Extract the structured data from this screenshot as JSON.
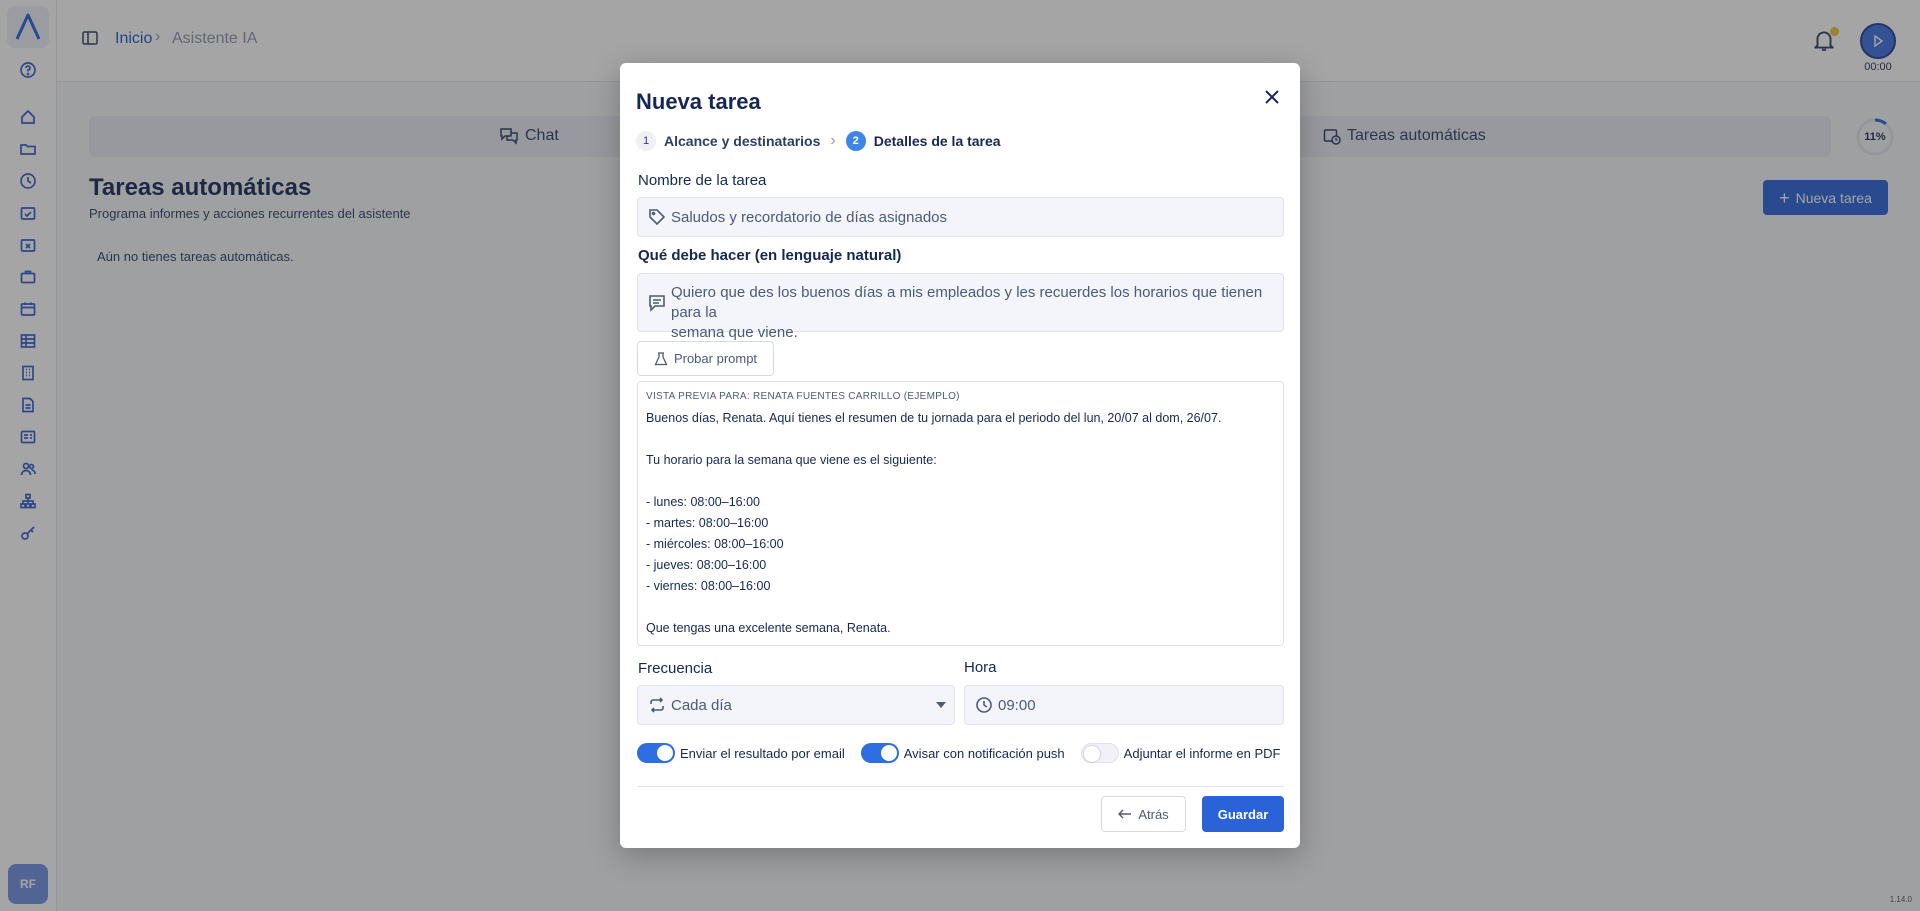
{
  "header": {
    "breadcrumb_home": "Inicio",
    "breadcrumb_current": "Asistente IA",
    "timer": "00:00"
  },
  "tabs": [
    {
      "label": "Chat",
      "icon": "chat-icon"
    },
    {
      "label": "Tareas automáticas",
      "icon": "calendar-clock-icon"
    }
  ],
  "progress": {
    "label": "11%",
    "value": 0.11
  },
  "page": {
    "title": "Tareas automáticas",
    "subtitle": "Programa informes y acciones recurrentes del asistente",
    "empty_message": "Aún no tienes tareas automáticas.",
    "new_task_label": "Nueva tarea"
  },
  "sidebar": {
    "avatar": "RF",
    "icons": [
      "help-icon",
      "home-icon",
      "folder-icon",
      "clock-icon",
      "calendar-check-icon",
      "calendar-x-icon",
      "briefcase-icon",
      "calendar-icon",
      "table-icon",
      "building-icon",
      "document-icon",
      "report-icon",
      "users-icon",
      "org-chart-icon",
      "key-icon"
    ]
  },
  "version": "1.14.0",
  "modal": {
    "title": "Nueva tarea",
    "steps": [
      {
        "number": "1",
        "label": "Alcance y destinatarios",
        "active": false
      },
      {
        "number": "2",
        "label": "Detalles de la tarea",
        "active": true
      }
    ],
    "task_name_label": "Nombre de la tarea",
    "task_name_value": "Saludos y recordatorio de días asignados",
    "instructions_label": "Qué debe hacer (en lenguaje natural)",
    "instructions_line1": "Quiero que des los buenos días a mis empleados y les recuerdes los horarios que tienen para la",
    "instructions_line2": "semana que viene.",
    "test_prompt_label": "Probar prompt",
    "preview": {
      "heading": "VISTA PREVIA PARA: RENATA FUENTES CARRILLO (EJEMPLO)",
      "lines": [
        "Buenos días, Renata. Aquí tienes el resumen de tu jornada para el periodo del lun, 20/07 al dom, 26/07.",
        "Tu horario para la semana que viene es el siguiente:",
        "- lunes: 08:00–16:00",
        "- martes: 08:00–16:00",
        "- miércoles: 08:00–16:00",
        "- jueves: 08:00–16:00",
        "- viernes: 08:00–16:00",
        "Que tengas una excelente semana, Renata."
      ]
    },
    "frequency_label": "Frecuencia",
    "frequency_value": "Cada día",
    "time_label": "Hora",
    "time_value": "09:00",
    "toggles": [
      {
        "label": "Enviar el resultado por email",
        "on": true
      },
      {
        "label": "Avisar con notificación push",
        "on": true
      },
      {
        "label": "Adjuntar el informe en PDF",
        "on": false
      }
    ],
    "back_label": "Atrás",
    "save_label": "Guardar"
  },
  "colors": {
    "accent": "#2a62d8",
    "title": "#152855"
  }
}
